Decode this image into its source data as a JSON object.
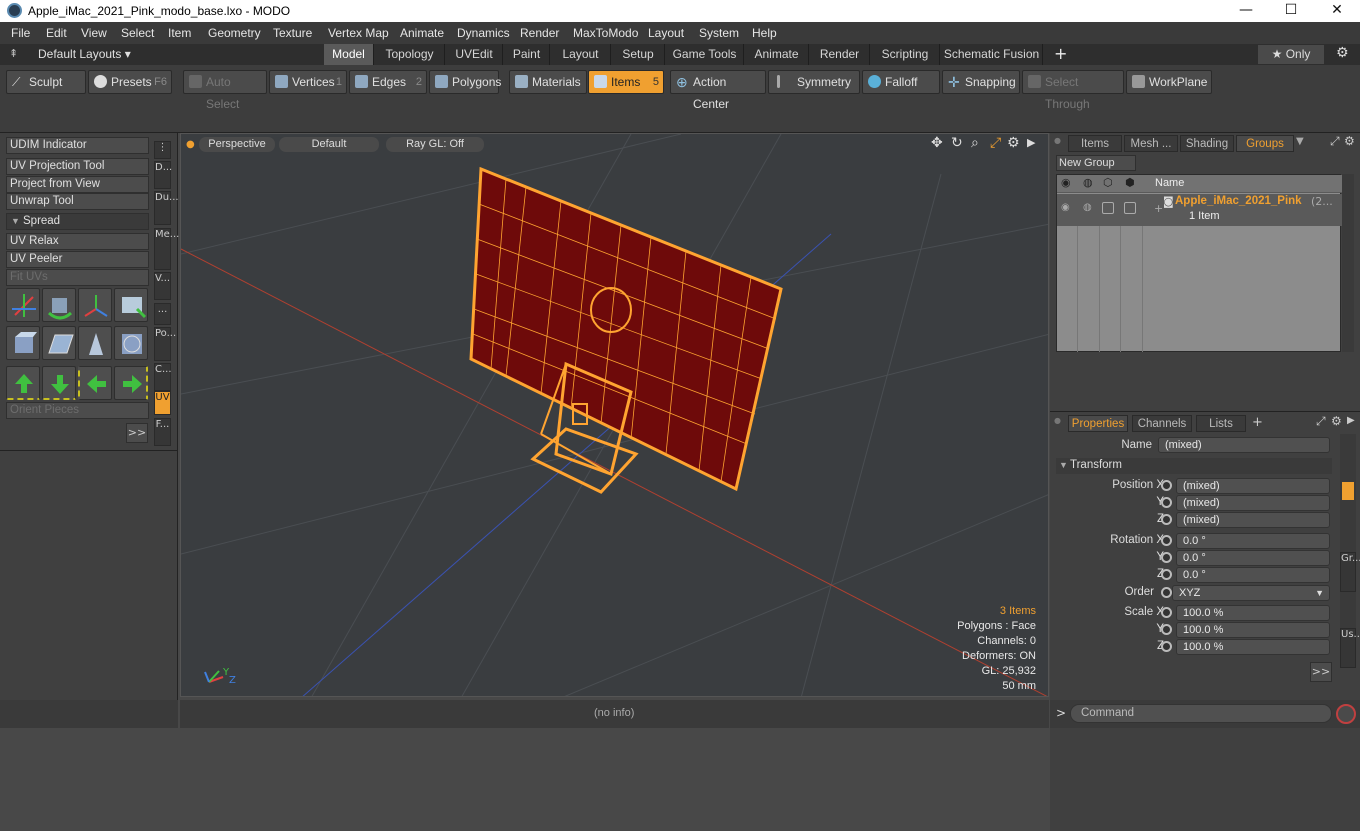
{
  "window": {
    "title": "Apple_iMac_2021_Pink_modo_base.lxo - MODO",
    "minimize": "—",
    "maximize": "☐",
    "close": "✕"
  },
  "menus": [
    "File",
    "Edit",
    "View",
    "Select",
    "Item",
    "Geometry",
    "Texture",
    "Vertex Map",
    "Animate",
    "Dynamics",
    "Render",
    "MaxToModo",
    "Layout",
    "System",
    "Help"
  ],
  "layoutbar": {
    "layouts_label": "Default Layouts ▾",
    "tabs": [
      "Model",
      "Topology",
      "UVEdit",
      "Paint",
      "Layout",
      "Setup",
      "Game Tools",
      "Animate",
      "Render",
      "Scripting",
      "Schematic Fusion"
    ],
    "active_tab": "Model",
    "add": "+",
    "only_label": "★ Only"
  },
  "toolbar": {
    "sculpt": "Sculpt",
    "presets": "Presets",
    "presets_key": "F6",
    "auto_select": "Auto Select",
    "vertices": "Vertices",
    "vertices_key": "1",
    "edges": "Edges",
    "edges_key": "2",
    "polygons": "Polygons",
    "materials": "Materials",
    "items": "Items",
    "items_key": "5",
    "action_center": "Action Center",
    "symmetry": "Symmetry",
    "falloff": "Falloff",
    "snapping": "Snapping",
    "select_through": "Select Through",
    "workplane": "WorkPlane"
  },
  "leftpanel": {
    "buttons": [
      "UDIM Indicator",
      "UV Projection Tool",
      "Project from View",
      "Unwrap Tool"
    ],
    "spread": "Spread",
    "buttons2": [
      "UV Relax",
      "UV Peeler"
    ],
    "fit_uvs": "Fit UVs",
    "orient_pieces": "Orient Pieces",
    "more": ">>",
    "vtabs": [
      "D...",
      "Du...",
      "Me...",
      "V...",
      "...",
      "Po...",
      "C...",
      "UV",
      "F..."
    ]
  },
  "viewport": {
    "view": "Perspective",
    "shading": "Default",
    "raygl": "Ray GL: Off",
    "stats": {
      "items": "3 Items",
      "polygons": "Polygons : Face",
      "channels": "Channels: 0",
      "deformers": "Deformers: ON",
      "gl": "GL: 25,932",
      "size": "50 mm"
    },
    "axis_y": "Y",
    "axis_z": "Z"
  },
  "status": {
    "info": "(no info)"
  },
  "groups": {
    "tabs": [
      "Items",
      "Mesh ...",
      "Shading",
      "Groups"
    ],
    "active_tab": "Groups",
    "new_group": "New Group",
    "name_header": "Name",
    "item_name": "Apple_iMac_2021_Pink",
    "item_suffix": "(2...",
    "item_count": "1 Item"
  },
  "properties": {
    "tabs": [
      "Properties",
      "Channels",
      "Lists"
    ],
    "add": "+",
    "name_label": "Name",
    "name_value": "(mixed)",
    "transform": "Transform",
    "position_label": "Position X",
    "position": [
      "(mixed)",
      "(mixed)",
      "(mixed)"
    ],
    "rotation_label": "Rotation X",
    "rotation": [
      "0.0 °",
      "0.0 °",
      "0.0 °"
    ],
    "order_label": "Order",
    "order_value": "XYZ",
    "scale_label": "Scale X",
    "scale": [
      "100.0 %",
      "100.0 %",
      "100.0 %"
    ],
    "y": "Y",
    "z": "Z",
    "more": ">>",
    "side_tabs": [
      "Gr...",
      "Us..."
    ]
  },
  "command": {
    "placeholder": "Command",
    "prompt": ">"
  },
  "colors": {
    "accent": "#f0a030",
    "wire": "#ffa431",
    "mesh_fill": "#6e0a0a"
  }
}
